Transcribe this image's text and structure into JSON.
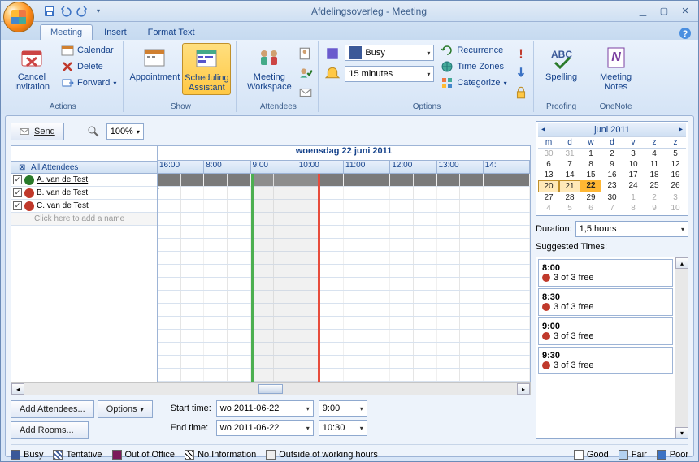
{
  "titlebar": {
    "title": "Afdelingsoverleg - Meeting"
  },
  "tabs": {
    "meeting": "Meeting",
    "insert": "Insert",
    "format": "Format Text"
  },
  "ribbon": {
    "actions": {
      "cancel": "Cancel Invitation",
      "calendar": "Calendar",
      "delete": "Delete",
      "forward": "Forward",
      "label": "Actions"
    },
    "show": {
      "appointment": "Appointment",
      "scheduling": "Scheduling Assistant",
      "label": "Show"
    },
    "attendees": {
      "workspace": "Meeting Workspace",
      "label": "Attendees"
    },
    "options": {
      "busy_label": "Busy",
      "reminder": "15 minutes",
      "recurrence": "Recurrence",
      "timezones": "Time Zones",
      "categorize": "Categorize",
      "label": "Options"
    },
    "proofing": {
      "spelling": "Spelling",
      "label": "Proofing"
    },
    "onenote": {
      "notes": "Meeting Notes",
      "label": "OneNote"
    }
  },
  "toolbar": {
    "send": "Send",
    "zoom": "100%",
    "add_attendees": "Add Attendees...",
    "options": "Options",
    "add_rooms": "Add Rooms..."
  },
  "schedule": {
    "date": "woensdag 22 juni 2011",
    "hours": [
      "16:00",
      "8:00",
      "9:00",
      "10:00",
      "11:00",
      "12:00",
      "13:00",
      "14:"
    ],
    "all_attendees": "All Attendees",
    "attendees": [
      {
        "name": "A. van de Test",
        "color": "#2a7a2a"
      },
      {
        "name": "B. van de Test",
        "color": "#c0392b"
      },
      {
        "name": "C. van de Test",
        "color": "#c0392b"
      }
    ],
    "add_name": "Click here to add a name"
  },
  "times": {
    "start_label": "Start time:",
    "end_label": "End time:",
    "start_date": "wo 2011-06-22",
    "start_time": "9:00",
    "end_date": "wo 2011-06-22",
    "end_time": "10:30"
  },
  "calendar": {
    "title": "juni 2011",
    "dow": [
      "m",
      "d",
      "w",
      "d",
      "v",
      "z",
      "z"
    ],
    "days": [
      {
        "n": 30,
        "o": 1
      },
      {
        "n": 31,
        "o": 1
      },
      {
        "n": 1
      },
      {
        "n": 2
      },
      {
        "n": 3
      },
      {
        "n": 4
      },
      {
        "n": 5
      },
      {
        "n": 6
      },
      {
        "n": 7
      },
      {
        "n": 8
      },
      {
        "n": 9
      },
      {
        "n": 10
      },
      {
        "n": 11
      },
      {
        "n": 12
      },
      {
        "n": 13
      },
      {
        "n": 14
      },
      {
        "n": 15
      },
      {
        "n": 16
      },
      {
        "n": 17
      },
      {
        "n": 18
      },
      {
        "n": 19
      },
      {
        "n": 20,
        "s": 1
      },
      {
        "n": 21,
        "s": 1
      },
      {
        "n": 22,
        "t": 1
      },
      {
        "n": 23
      },
      {
        "n": 24
      },
      {
        "n": 25
      },
      {
        "n": 26
      },
      {
        "n": 27
      },
      {
        "n": 28
      },
      {
        "n": 29
      },
      {
        "n": 30
      },
      {
        "n": 1,
        "o": 1
      },
      {
        "n": 2,
        "o": 1
      },
      {
        "n": 3,
        "o": 1
      },
      {
        "n": 4,
        "o": 1
      },
      {
        "n": 5,
        "o": 1
      },
      {
        "n": 6,
        "o": 1
      },
      {
        "n": 7,
        "o": 1
      },
      {
        "n": 8,
        "o": 1
      },
      {
        "n": 9,
        "o": 1
      },
      {
        "n": 10,
        "o": 1
      }
    ]
  },
  "duration": {
    "label": "Duration:",
    "value": "1,5 hours"
  },
  "suggestions": {
    "label": "Suggested Times:",
    "items": [
      {
        "time": "8:00",
        "free": "3 of 3 free"
      },
      {
        "time": "8:30",
        "free": "3 of 3 free"
      },
      {
        "time": "9:00",
        "free": "3 of 3 free"
      },
      {
        "time": "9:30",
        "free": "3 of 3 free"
      }
    ]
  },
  "legend": {
    "busy": "Busy",
    "tentative": "Tentative",
    "ooo": "Out of Office",
    "noinfo": "No Information",
    "outside": "Outside of working hours",
    "good": "Good",
    "fair": "Fair",
    "poor": "Poor"
  }
}
